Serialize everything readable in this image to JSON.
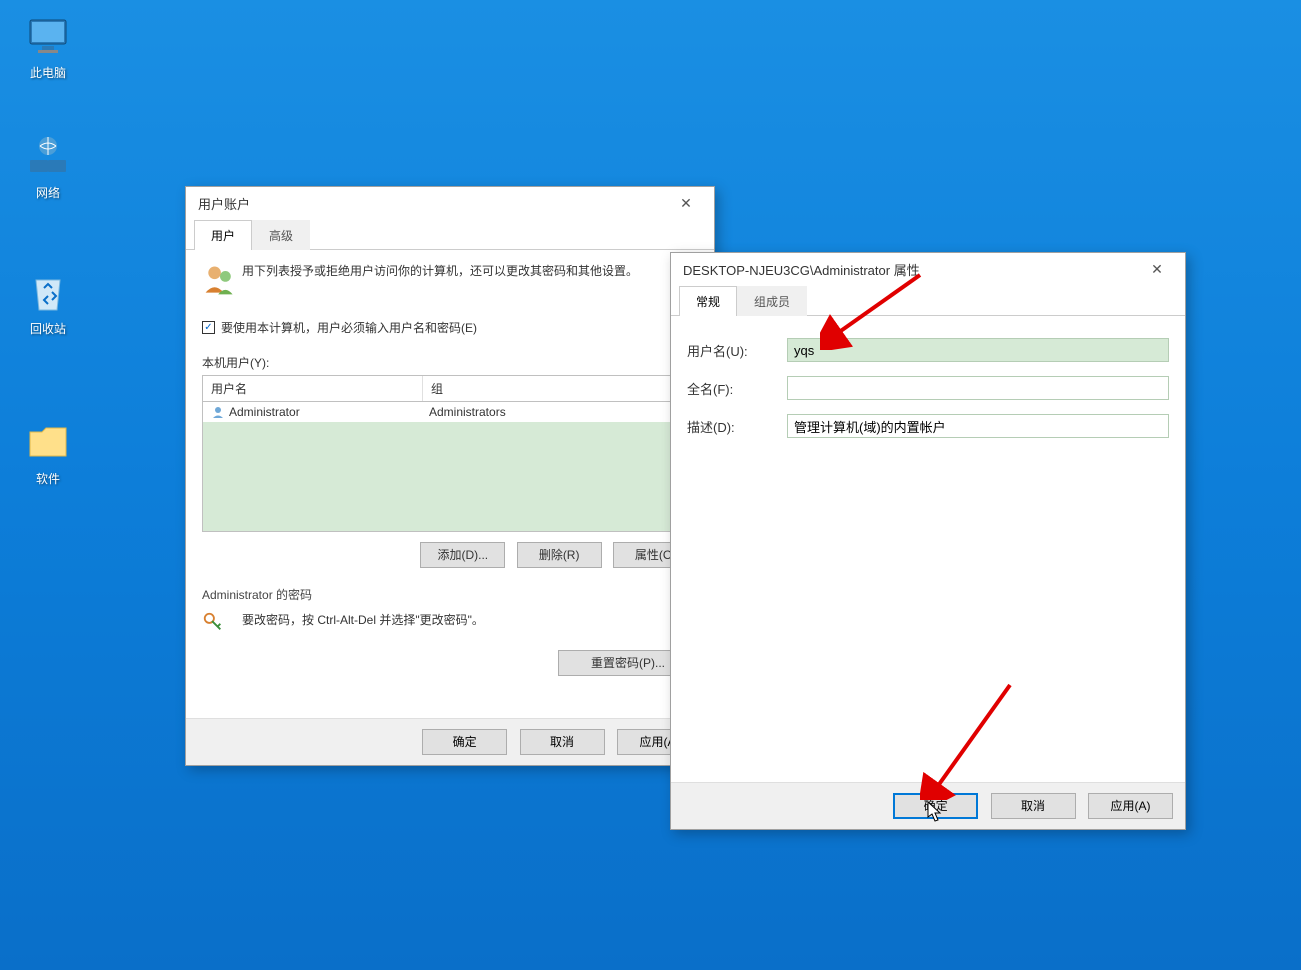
{
  "desktop": {
    "icons": [
      {
        "label": "此电脑"
      },
      {
        "label": "网络"
      },
      {
        "label": "回收站"
      },
      {
        "label": "软件"
      }
    ]
  },
  "dialog1": {
    "title": "用户账户",
    "tabs": {
      "users": "用户",
      "advanced": "高级"
    },
    "desc": "用下列表授予或拒绝用户访问你的计算机，还可以更改其密码和其他设置。",
    "checkbox": "要使用本计算机，用户必须输入用户名和密码(E)",
    "list_label": "本机用户(Y):",
    "columns": {
      "user": "用户名",
      "group": "组"
    },
    "rows": [
      {
        "user": "Administrator",
        "group": "Administrators"
      }
    ],
    "buttons": {
      "add": "添加(D)...",
      "remove": "删除(R)",
      "properties": "属性(O)"
    },
    "pw_section_title": "Administrator 的密码",
    "pw_desc": "要改密码，按 Ctrl-Alt-Del 并选择\"更改密码\"。",
    "reset_pw": "重置密码(P)...",
    "bottom": {
      "ok": "确定",
      "cancel": "取消",
      "apply": "应用(A)"
    }
  },
  "dialog2": {
    "title": "DESKTOP-NJEU3CG\\Administrator 属性",
    "tabs": {
      "general": "常规",
      "members": "组成员"
    },
    "fields": {
      "username_label": "用户名(U):",
      "username_value": "yqs",
      "fullname_label": "全名(F):",
      "fullname_value": "",
      "desc_label": "描述(D):",
      "desc_value": "管理计算机(域)的内置帐户"
    },
    "bottom": {
      "ok": "确定",
      "cancel": "取消",
      "apply": "应用(A)"
    }
  }
}
